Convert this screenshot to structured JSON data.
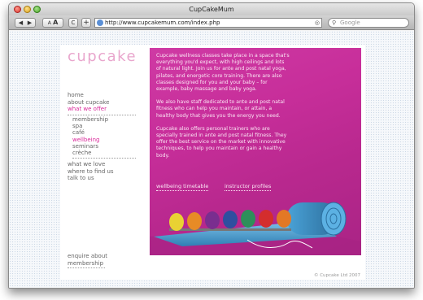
{
  "window": {
    "title": "CupCakeMum"
  },
  "toolbar": {
    "back": "◀",
    "forward": "▶",
    "font_small": "A",
    "font_large": "A",
    "reload": "C",
    "add": "+",
    "url": "http://www.cupcakemum.com/index.php",
    "search_placeholder": "Google"
  },
  "site": {
    "logo": "cupcake",
    "nav_main": [
      "home",
      "about cupcake",
      "what we offer"
    ],
    "nav_sub": [
      "membership",
      "spa",
      "café",
      "wellbeing",
      "seminars",
      "crèche"
    ],
    "nav_lower": [
      "what we love",
      "where to find us",
      "talk to us"
    ],
    "enquire": [
      "enquire about",
      "membership"
    ],
    "paragraphs": [
      "Cupcake wellness classes take place in a space that's everything you'd expect, with high ceilings and lots of natural light. Join us for ante and post natal yoga, pilates, and energetic core training. There are also classes designed for you and your baby – for example, baby massage and baby yoga.",
      "We also have staff dedicated to ante and post natal fitness who can help you maintain, or attain, a healthy body that gives you the energy you need.",
      "Cupcake also offers personal trainers who are specially trained in ante and post natal fitness. They offer the best service on the market with innovative techniques, to help you maintain or gain a healthy body."
    ],
    "link_timetable": "wellbeing timetable",
    "link_instructor": "instructor profiles",
    "footer": "© Cupcake Ltd 2007"
  },
  "colors": {
    "accent": "#d9299a",
    "logo": "#e9a6cd",
    "hero": "#c72e9a"
  }
}
